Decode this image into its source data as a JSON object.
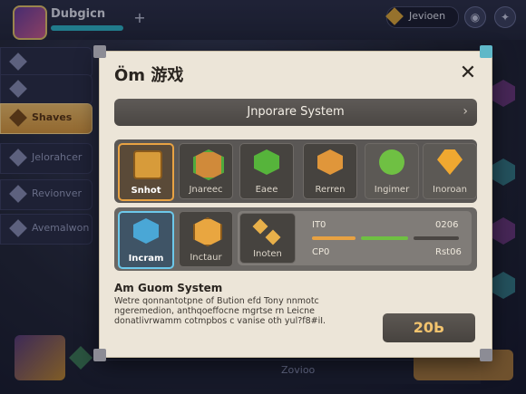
{
  "hud": {
    "player_name": "Dubgicn",
    "currency_value": "Jevioen",
    "top_plus": "+",
    "top_icon_1": "◉",
    "top_icon_2": "✦"
  },
  "sidebar": {
    "items": [
      {
        "label": "",
        "icon": "sword-icon"
      },
      {
        "label": "",
        "icon": "shield-icon"
      },
      {
        "label": "Shaves",
        "icon": "gem-icon",
        "active": true
      },
      {
        "label": "Jelorahcer",
        "icon": "scroll-icon"
      },
      {
        "label": "Revionver",
        "icon": "map-icon"
      },
      {
        "label": "Avemalwon",
        "icon": "flag-icon"
      }
    ]
  },
  "bottom_bar": {
    "label": "Zovioo"
  },
  "modal": {
    "title": "Öm 游戏",
    "close": "✕",
    "system_bar": "Jnporare System",
    "system_chevron": "›",
    "row1": [
      {
        "label": "Snhot",
        "icon": "gold-frame-icon",
        "selected": true
      },
      {
        "label": "Jnareec",
        "icon": "green-hex-icon"
      },
      {
        "label": "Eaee",
        "icon": "green-gem-icon"
      },
      {
        "label": "Rerren",
        "icon": "orange-hex-icon"
      },
      {
        "label": "Ingimer",
        "icon": "green-orb-icon"
      },
      {
        "label": "Inoroan",
        "icon": "orange-gem-icon"
      }
    ],
    "row2": [
      {
        "label": "Incram",
        "icon": "blue-hex-icon",
        "selected": true
      },
      {
        "label": "Inctaur",
        "icon": "honeycomb-icon"
      },
      {
        "label": "Inoten",
        "icon": "cubes-icon"
      }
    ],
    "stats": {
      "label_1": "IT0",
      "value_1": "0206",
      "label_2": "CP0",
      "value_2": "Rst06",
      "bar_colors": [
        "#e8a243",
        "#6fc043",
        "#4a4643"
      ]
    },
    "desc_title": "Am Guom System",
    "desc_text": "Wetre qonnantotpne of Bution efd Tony nnmotc ngeremedion, anthqoeffocne mgrtse rn Leicne donatlivrwamm cotmpbos c vanise oth yul?f8#iI.",
    "buy_label": "20Ь"
  }
}
